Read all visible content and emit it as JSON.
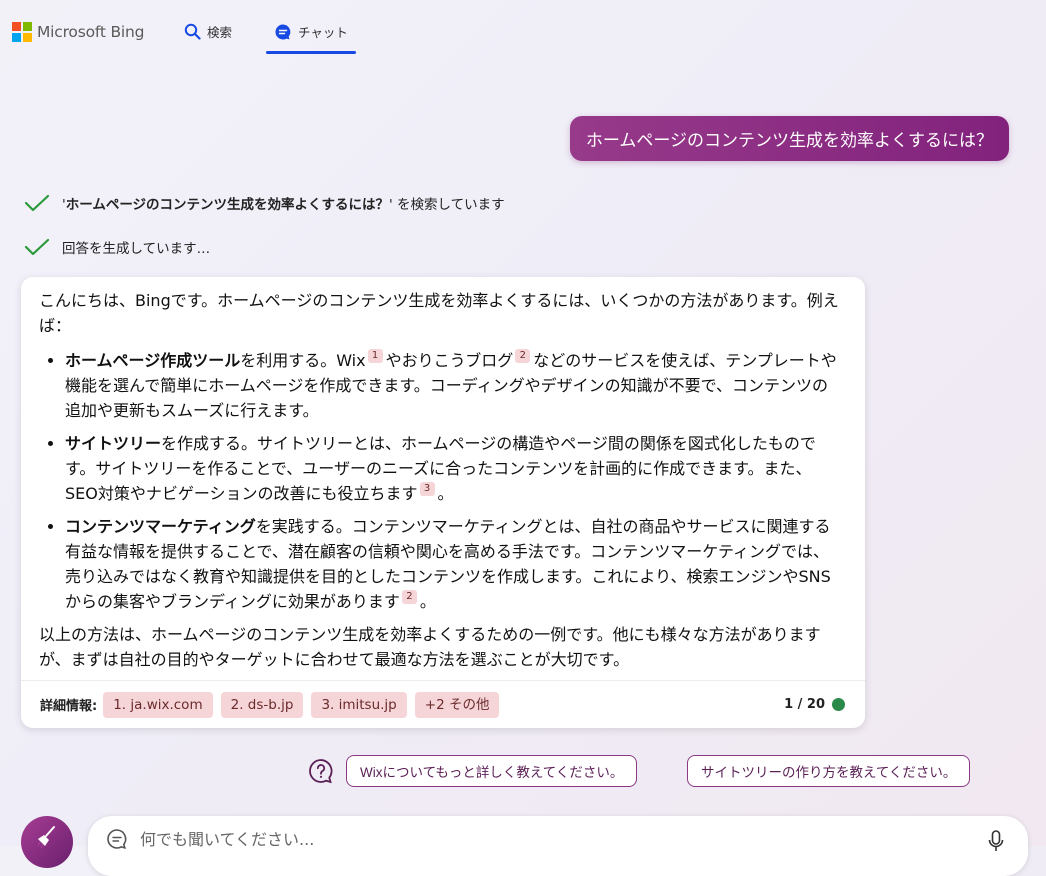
{
  "header": {
    "brand": "Microsoft Bing",
    "logo_colors": [
      "#f25022",
      "#7fba00",
      "#00a4ef",
      "#ffb900"
    ],
    "tabs": [
      {
        "label": "検索",
        "icon": "search-icon",
        "active": false
      },
      {
        "label": "チャット",
        "icon": "chat-icon",
        "active": true
      }
    ],
    "accent_color": "#174ae4"
  },
  "user_message": "ホームページのコンテンツ生成を効率よくするには？",
  "progress": {
    "search_query": "ホームページのコンテンツ生成を効率よくするには？",
    "search_prefix": "'",
    "search_suffix": "' を検索しています",
    "generating": "回答を生成しています…"
  },
  "answer": {
    "intro": "こんにちは、Bingです。ホームページのコンテンツ生成を効率よくするには、いくつかの方法があります。例えば：",
    "items": [
      {
        "bold": "ホームページ作成ツール",
        "t1": "を利用する。Wix",
        "c1": "1",
        "t2": "やおりこうブログ",
        "c2": "2",
        "t3": "などのサービスを使えば、テンプレートや機能を選んで簡単にホームページを作成できます。コーディングやデザインの知識が不要で、コンテンツの追加や更新もスムーズに行えます。"
      },
      {
        "bold": "サイトツリー",
        "t1": "を作成する。サイトツリーとは、ホームページの構造やページ間の関係を図式化したものです。サイトツリーを作ることで、ユーザーのニーズに合ったコンテンツを計画的に作成できます。また、SEO対策やナビゲーションの改善にも役立ちます",
        "c1": "3",
        "t2": "。"
      },
      {
        "bold": "コンテンツマーケティング",
        "t1": "を実践する。コンテンツマーケティングとは、自社の商品やサービスに関連する有益な情報を提供することで、潜在顧客の信頼や関心を高める手法です。コンテンツマーケティングでは、売り込みではなく教育や知識提供を目的としたコンテンツを作成します。これにより、検索エンジンやSNSからの集客やブランディングに効果があります",
        "c1": "2",
        "t2": "。"
      }
    ],
    "closing": "以上の方法は、ホームページのコンテンツ生成を効率よくするための一例です。他にも様々な方法がありますが、まずは自社の目的やターゲットに合わせて最適な方法を選ぶことが大切です。",
    "footer": {
      "label": "詳細情報:",
      "sources": [
        "1. ja.wix.com",
        "2. ds-b.jp",
        "3. imitsu.jp",
        "+2 その他"
      ],
      "count": "1 / 20",
      "status_color": "#2a8a4a"
    }
  },
  "suggestions": [
    "Wixについてもっと詳しく教えてください。",
    "サイトツリーの作り方を教えてください。"
  ],
  "input": {
    "placeholder": "何でも聞いてください..."
  }
}
